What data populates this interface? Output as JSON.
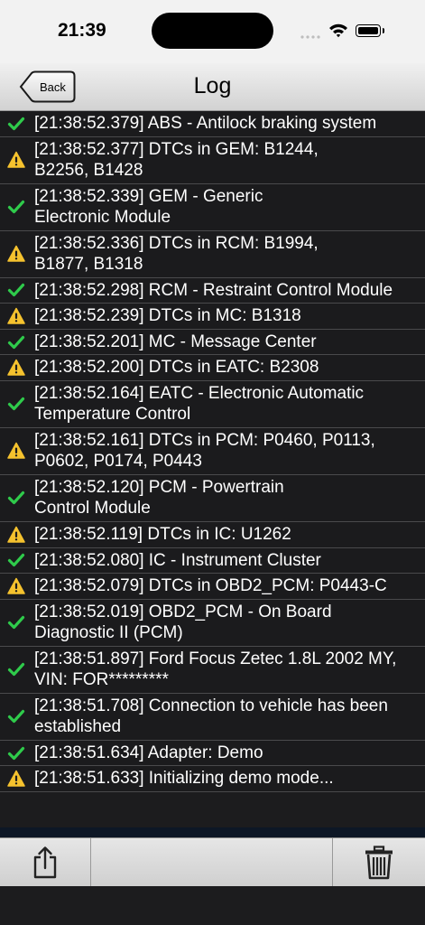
{
  "status": {
    "time": "21:39"
  },
  "nav": {
    "back_label": "Back",
    "title": "Log"
  },
  "colors": {
    "ok": "#2fcb4b",
    "warning": "#f5c22e"
  },
  "log": [
    {
      "type": "ok",
      "text": "[21:38:52.379] ABS - Antilock braking system"
    },
    {
      "type": "warning",
      "text": "[21:38:52.377] DTCs in GEM: B1244,\nB2256, B1428"
    },
    {
      "type": "ok",
      "text": "[21:38:52.339] GEM - Generic\nElectronic Module"
    },
    {
      "type": "warning",
      "text": "[21:38:52.336] DTCs in RCM: B1994,\nB1877, B1318"
    },
    {
      "type": "ok",
      "text": "[21:38:52.298] RCM - Restraint Control Module"
    },
    {
      "type": "warning",
      "text": "[21:38:52.239] DTCs in MC: B1318"
    },
    {
      "type": "ok",
      "text": "[21:38:52.201] MC - Message Center"
    },
    {
      "type": "warning",
      "text": "[21:38:52.200] DTCs in EATC: B2308"
    },
    {
      "type": "ok",
      "text": "[21:38:52.164] EATC - Electronic Automatic\nTemperature Control"
    },
    {
      "type": "warning",
      "text": "[21:38:52.161] DTCs in PCM: P0460, P0113,\nP0602, P0174, P0443"
    },
    {
      "type": "ok",
      "text": "[21:38:52.120] PCM - Powertrain\nControl Module"
    },
    {
      "type": "warning",
      "text": "[21:38:52.119] DTCs in IC: U1262"
    },
    {
      "type": "ok",
      "text": "[21:38:52.080] IC - Instrument Cluster"
    },
    {
      "type": "warning",
      "text": "[21:38:52.079] DTCs in OBD2_PCM: P0443-C"
    },
    {
      "type": "ok",
      "text": "[21:38:52.019] OBD2_PCM - On Board\nDiagnostic II (PCM)"
    },
    {
      "type": "ok",
      "text": "[21:38:51.897] Ford Focus Zetec 1.8L 2002 MY,\nVIN: FOR*********"
    },
    {
      "type": "ok",
      "text": "[21:38:51.708] Connection to vehicle has been\nestablished"
    },
    {
      "type": "ok",
      "text": "[21:38:51.634] Adapter:  Demo"
    },
    {
      "type": "warning",
      "text": "[21:38:51.633] Initializing demo mode..."
    }
  ],
  "toolbar": {
    "left_icon": "share-icon",
    "right_icon": "trash-icon"
  }
}
